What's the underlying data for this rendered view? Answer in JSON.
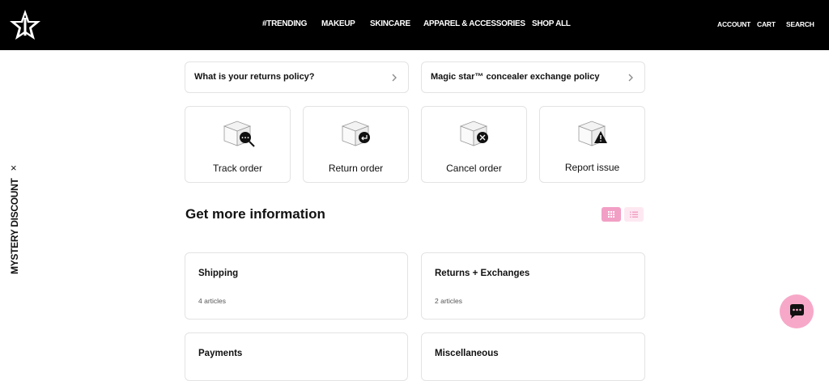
{
  "header": {
    "nav": [
      "#TRENDING",
      "MAKEUP",
      "SKINCARE",
      "APPAREL & ACCESSORIES",
      "SHOP ALL"
    ],
    "utility": [
      "ACCOUNT",
      "CART",
      "SEARCH"
    ]
  },
  "faq": [
    {
      "label": "What is your returns policy?"
    },
    {
      "label": "Magic star™ concealer exchange policy"
    }
  ],
  "actions": [
    {
      "label": "Track order",
      "icon": "track-order-icon"
    },
    {
      "label": "Return order",
      "icon": "return-order-icon"
    },
    {
      "label": "Cancel order",
      "icon": "cancel-order-icon"
    },
    {
      "label": "Report issue",
      "icon": "report-issue-icon"
    }
  ],
  "section": {
    "title": "Get more information"
  },
  "categories": [
    {
      "title": "Shipping",
      "count": "4 articles"
    },
    {
      "title": "Returns + Exchanges",
      "count": "2 articles"
    },
    {
      "title": "Payments",
      "count": ""
    },
    {
      "title": "Miscellaneous",
      "count": ""
    }
  ],
  "side_tab": {
    "label": "MYSTERY DISCOUNT",
    "close": "×"
  },
  "colors": {
    "topbar": "#000000",
    "accent_pink": "#f29fc5",
    "chat_pink": "#f7a8c8"
  }
}
